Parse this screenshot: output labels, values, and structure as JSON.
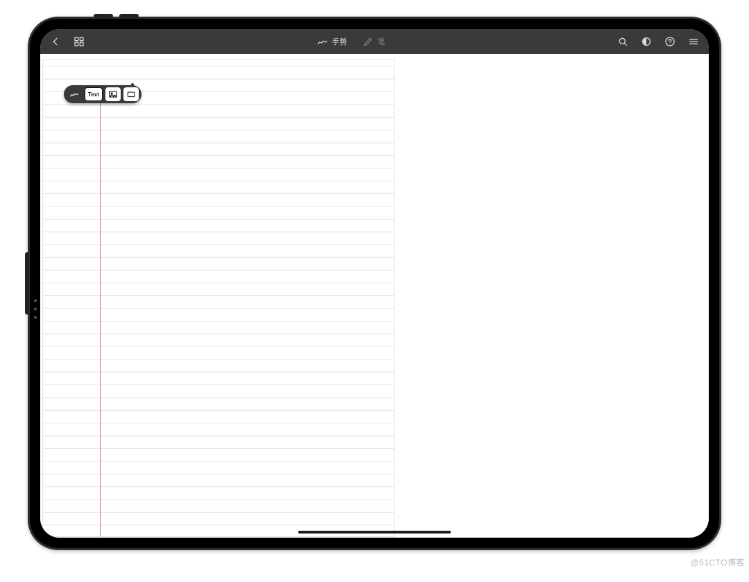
{
  "appbar": {
    "mode_gesture_label": "手势",
    "mode_pen_label": "笔"
  },
  "toolpill": {
    "text_btn_label": "Text"
  },
  "watermark": "@51CTO博客"
}
